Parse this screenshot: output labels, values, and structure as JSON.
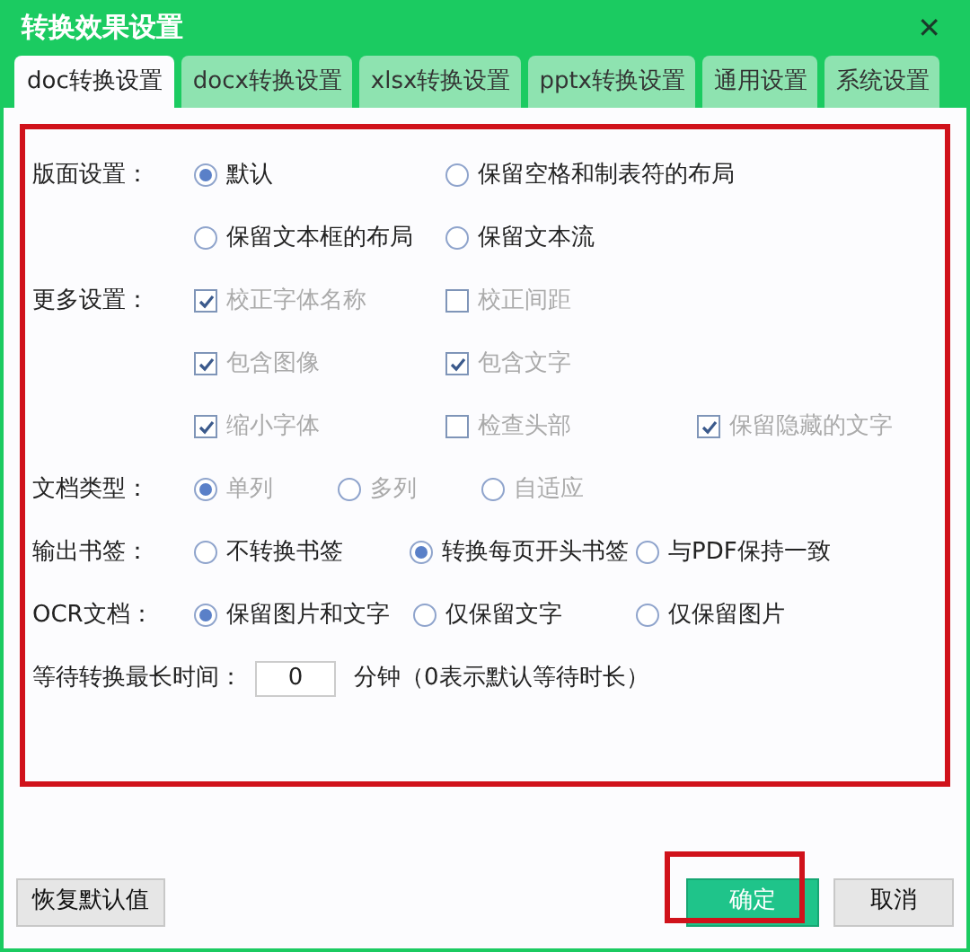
{
  "window": {
    "title": "转换效果设置",
    "close": "✕"
  },
  "tabs": [
    {
      "label": "doc转换设置",
      "selected": true
    },
    {
      "label": "docx转换设置",
      "selected": false
    },
    {
      "label": "xlsx转换设置",
      "selected": false
    },
    {
      "label": "pptx转换设置",
      "selected": false
    },
    {
      "label": "通用设置",
      "selected": false
    },
    {
      "label": "系统设置",
      "selected": false
    }
  ],
  "sections": [
    {
      "label": "版面设置：",
      "kind": "radio",
      "rows": [
        [
          {
            "label": "默认",
            "selected": true,
            "disabled": false
          },
          {
            "label": "保留空格和制表符的布局",
            "selected": false,
            "disabled": false
          }
        ],
        [
          {
            "label": "保留文本框的布局",
            "selected": false,
            "disabled": false
          },
          {
            "label": "保留文本流",
            "selected": false,
            "disabled": false
          }
        ]
      ]
    },
    {
      "label": "更多设置：",
      "kind": "checkbox",
      "rows": [
        [
          {
            "label": "校正字体名称",
            "checked": true,
            "disabled": true
          },
          {
            "label": "校正间距",
            "checked": false,
            "disabled": true
          }
        ],
        [
          {
            "label": "包含图像",
            "checked": true,
            "disabled": true
          },
          {
            "label": "包含文字",
            "checked": true,
            "disabled": true
          }
        ],
        [
          {
            "label": "缩小字体",
            "checked": true,
            "disabled": true
          },
          {
            "label": "检查头部",
            "checked": false,
            "disabled": true
          },
          {
            "label": "保留隐藏的文字",
            "checked": true,
            "disabled": true
          }
        ]
      ]
    },
    {
      "label": "文档类型：",
      "kind": "radio",
      "rows": [
        [
          {
            "label": "单列",
            "selected": true,
            "disabled": true
          },
          {
            "label": "多列",
            "selected": false,
            "disabled": true
          },
          {
            "label": "自适应",
            "selected": false,
            "disabled": true
          }
        ]
      ]
    },
    {
      "label": "输出书签：",
      "kind": "radio",
      "rows": [
        [
          {
            "label": "不转换书签",
            "selected": false,
            "disabled": false
          },
          {
            "label": "转换每页开头书签",
            "selected": true,
            "disabled": false
          },
          {
            "label": "与PDF保持一致",
            "selected": false,
            "disabled": false
          }
        ]
      ]
    },
    {
      "label": "OCR文档：",
      "kind": "radio",
      "rows": [
        [
          {
            "label": "保留图片和文字",
            "selected": true,
            "disabled": false
          },
          {
            "label": "仅保留文字",
            "selected": false,
            "disabled": false
          },
          {
            "label": "仅保留图片",
            "selected": false,
            "disabled": false
          }
        ]
      ]
    }
  ],
  "wait": {
    "label": "等待转换最长时间：",
    "value": "0",
    "note": "分钟（0表示默认等待时长）"
  },
  "buttons": [
    {
      "label": "恢复默认值",
      "kind": "plain"
    },
    {
      "label": "确定",
      "kind": "primary"
    },
    {
      "label": "取消",
      "kind": "plain"
    }
  ]
}
